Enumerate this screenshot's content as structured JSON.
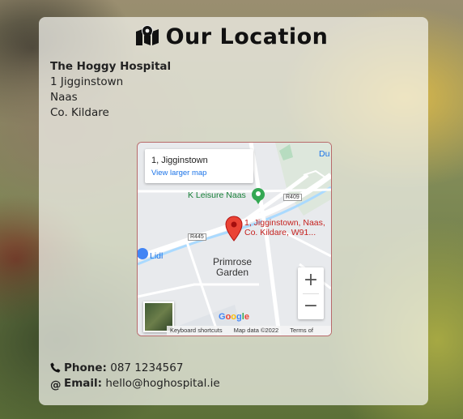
{
  "heading": {
    "title": "Our Location",
    "icon": "map-marked-icon"
  },
  "address": {
    "name": "The Hoggy Hospital",
    "line1": "1 Jigginstown",
    "line2": "Naas",
    "line3": "Co. Kildare"
  },
  "map": {
    "place_title": "1, Jigginstown",
    "larger_map_link": "View larger map",
    "poi_leisure": "K Leisure Naas",
    "road_r409": "R409",
    "road_r445": "R445",
    "marker_label_line1": "1, Jigginstown, Naas,",
    "marker_label_line2": "Co. Kildare, W91...",
    "poi_lidl": "Lidl",
    "area_line1": "Primrose",
    "area_line2": "Garden",
    "edge_label": "Du",
    "zoom_in": "+",
    "zoom_out": "−",
    "google_logo": "Google",
    "keyboard_shortcuts": "Keyboard shortcuts",
    "map_data": "Map data ©2022",
    "terms": "Terms of Use",
    "colors": {
      "marker": "#ea4335",
      "link": "#1a73e8",
      "road": "#ffffff",
      "water": "#aadaff"
    }
  },
  "contact": {
    "phone_label": "Phone:",
    "phone_value": "087 1234567",
    "email_label": "Email:",
    "email_value": "hello@hoghospital.ie"
  }
}
